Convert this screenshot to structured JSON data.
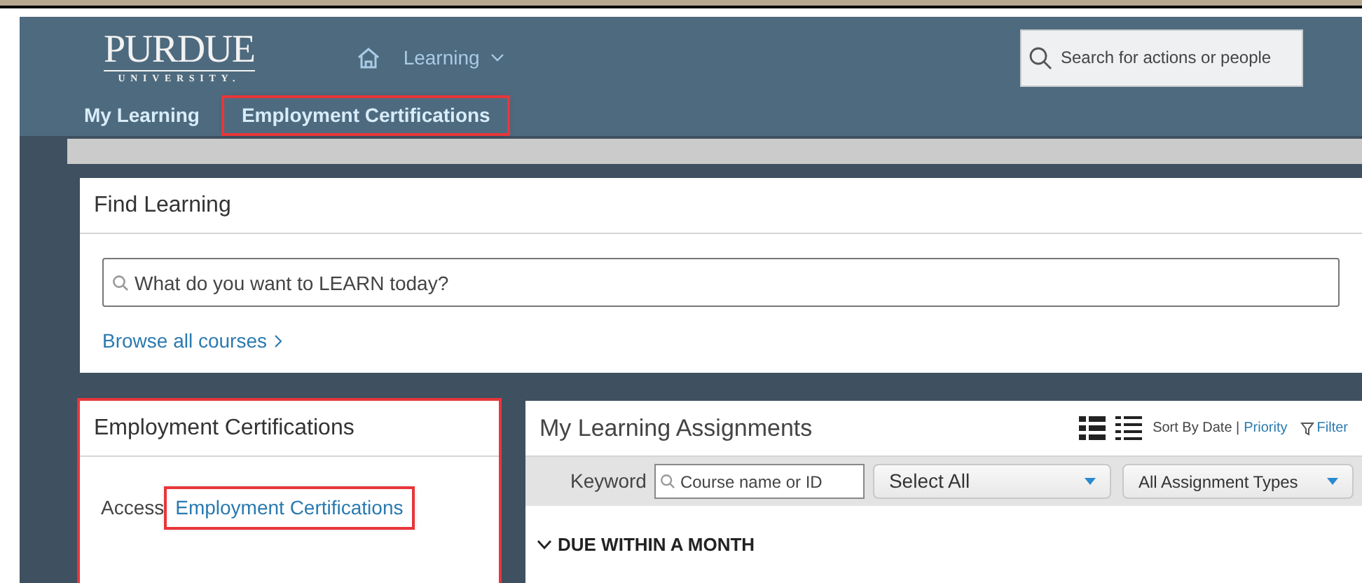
{
  "header": {
    "logo": {
      "name": "PURDUE",
      "sub": "UNIVERSITY."
    },
    "menu": {
      "label": "Learning"
    },
    "search": {
      "placeholder": "Search for actions or people"
    },
    "tabs": [
      {
        "label": "My Learning",
        "highlighted": false
      },
      {
        "label": "Employment Certifications",
        "highlighted": true
      }
    ]
  },
  "find_learning": {
    "title": "Find Learning",
    "search": {
      "placeholder": "What do you want to LEARN today?"
    },
    "link": "Browse all courses"
  },
  "certifications_panel": {
    "title": "Employment Certifications",
    "highlighted": true,
    "text": "Access",
    "link": {
      "label": "Employment Certifications",
      "highlighted": true
    }
  },
  "assignments": {
    "title": "My Learning Assignments",
    "sort_label": "Sort By Date |",
    "sort_link": "Priority",
    "filter": "Filter",
    "keyword_label": "Keyword",
    "keyword": {
      "placeholder": "Course name or ID"
    },
    "dropdowns": [
      "Select All",
      "All Assignment Types"
    ],
    "section": "DUE WITHIN A MONTH"
  }
}
